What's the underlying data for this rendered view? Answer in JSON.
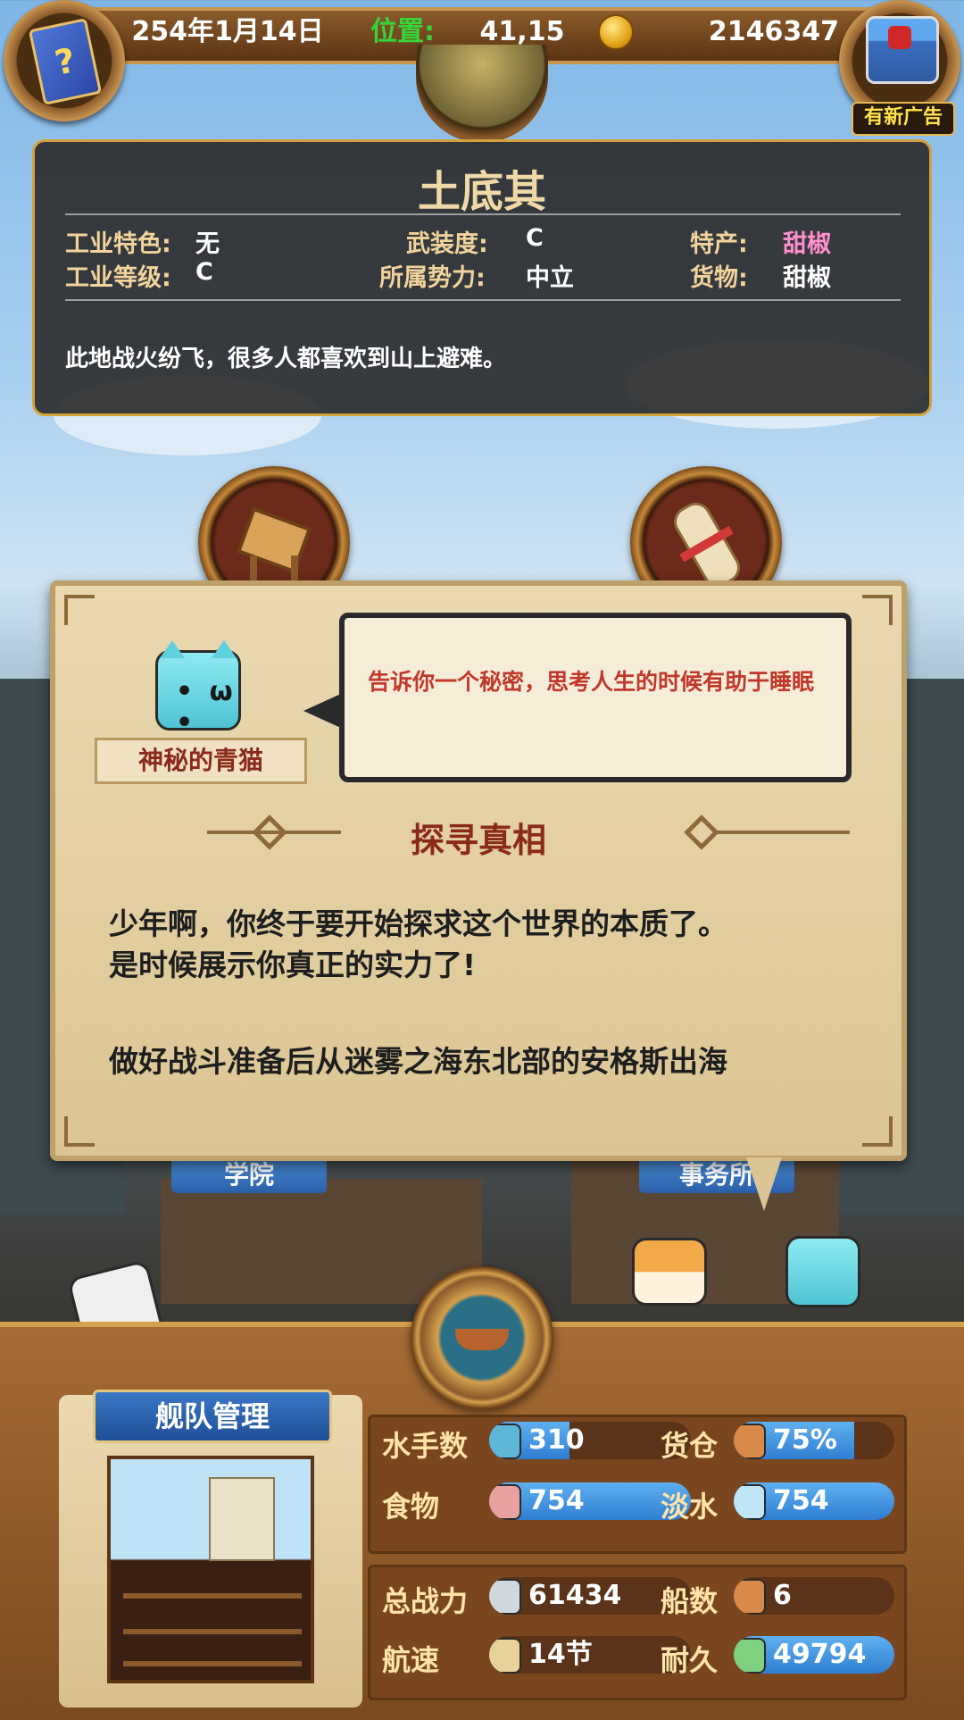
{
  "topbar": {
    "date": "254年1月14日",
    "location_label": "位置:",
    "location_value": "41,15",
    "gold": "2146347",
    "ad_label": "有新广告",
    "book_glyph": "?"
  },
  "city": {
    "name": "土底其",
    "industry_feature_label": "工业特色:",
    "industry_feature_value": "无",
    "industry_level_label": "工业等级:",
    "industry_level_value": "C",
    "armament_label": "武装度:",
    "armament_value": "C",
    "faction_label": "所属势力:",
    "faction_value": "中立",
    "specialty_label": "特产:",
    "specialty_value": "甜椒",
    "goods_label": "货物:",
    "goods_value": "甜椒",
    "description": "此地战火纷飞，很多人都喜欢到山上避难。",
    "specialty_color": "#ff8fcc"
  },
  "buildings": {
    "left_ribbon": "学院",
    "right_ribbon": "事务所"
  },
  "dialog": {
    "speaker_name": "神秘的青猫",
    "speaker_face": "• ω •",
    "bubble_text": "告诉你一个秘密，思考人生的时候有助于睡眠",
    "quest_title": "探寻真相",
    "line1": "少年啊，你终于要开始探求这个世界的本质了。",
    "line2": "是时候展示你真正的实力了!",
    "line3": "做好战斗准备后从迷雾之海东北部的安格斯出海"
  },
  "fleet": {
    "title": "舰队管理",
    "sailors_label": "水手数",
    "sailors_value": "310",
    "cargo_label": "货仓",
    "cargo_value": "75%",
    "cargo_fill": 0.75,
    "food_label": "食物",
    "food_value": "754",
    "water_label": "淡水",
    "water_value": "754",
    "power_label": "总战力",
    "power_value": "61434",
    "ships_label": "船数",
    "ships_value": "6",
    "speed_label": "航速",
    "speed_value": "14节",
    "durability_label": "耐久",
    "durability_value": "49794"
  },
  "icons": [
    "book-icon",
    "coin-icon",
    "treasure-chest-icon",
    "globe-icon",
    "pier-icon",
    "scroll-icon",
    "ship-wheel-icon",
    "sailor-icon",
    "cargo-crate-icon",
    "meat-icon",
    "water-jug-icon",
    "crossed-swords-icon",
    "ship-icon",
    "sail-icon",
    "durability-icon"
  ],
  "colors": {
    "location_label": "#37d43a",
    "accent_gold": "#d4a23a",
    "bar_fill": "#2f7ed2",
    "bubble_text": "#c0392b"
  }
}
